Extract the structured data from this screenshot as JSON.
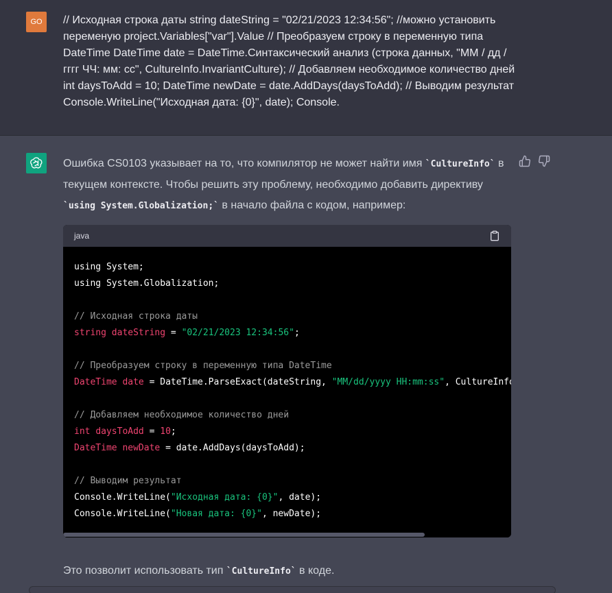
{
  "user": {
    "avatar_initials": "GO",
    "message": "// Исходная строка даты string dateString = \"02/21/2023 12:34:56\"; //можно установить переменую project.Variables[\"var\"].Value // Преобразуем строку в переменную типа DateTime DateTime date = DateTime.Синтаксический анализ (строка данных, \"ММ / дд / гггг ЧЧ: мм: сс\", CultureInfo.InvariantCulture); // Добавляем необходимое количество дней int daysToAdd = 10; DateTime newDate = date.AddDays(daysToAdd); // Выводим результат Console.WriteLine(\"Исходная дата: {0}\", date); Console."
  },
  "assistant": {
    "intro_1": "Ошибка CS0103 указывает на то, что компилятор не может найти имя ",
    "intro_code_1": "`CultureInfo`",
    "intro_2": " в текущем контексте. Чтобы решить эту проблему, необходимо добавить директиву ",
    "intro_code_2": "`using System.Globalization;`",
    "intro_3": " в начало файла с кодом, например:",
    "footer_1": "Это позволит использовать тип ",
    "footer_code": "`CultureInfo`",
    "footer_2": " в коде."
  },
  "code_block": {
    "language": "java",
    "copy_icon": "clipboard-icon",
    "lines": [
      [
        {
          "t": "using System;",
          "c": ""
        }
      ],
      [
        {
          "t": "using System.Globalization;",
          "c": ""
        }
      ],
      [],
      [
        {
          "t": "// Исходная строка даты",
          "c": "cm"
        }
      ],
      [
        {
          "t": "string",
          "c": "kw"
        },
        {
          "t": " ",
          "c": ""
        },
        {
          "t": "dateString",
          "c": "kw"
        },
        {
          "t": " = ",
          "c": ""
        },
        {
          "t": "\"02/21/2023 12:34:56\"",
          "c": "str"
        },
        {
          "t": ";",
          "c": ""
        }
      ],
      [],
      [
        {
          "t": "// Преобразуем строку в переменную типа DateTime",
          "c": "cm"
        }
      ],
      [
        {
          "t": "DateTime",
          "c": "kw"
        },
        {
          "t": " ",
          "c": ""
        },
        {
          "t": "date",
          "c": "kw"
        },
        {
          "t": " = DateTime.ParseExact(dateString, ",
          "c": ""
        },
        {
          "t": "\"MM/dd/yyyy HH:mm:ss\"",
          "c": "str"
        },
        {
          "t": ", CultureInfo.",
          "c": ""
        }
      ],
      [],
      [
        {
          "t": "// Добавляем необходимое количество дней",
          "c": "cm"
        }
      ],
      [
        {
          "t": "int",
          "c": "kw"
        },
        {
          "t": " ",
          "c": ""
        },
        {
          "t": "daysToAdd",
          "c": "kw"
        },
        {
          "t": " = ",
          "c": ""
        },
        {
          "t": "10",
          "c": "kw"
        },
        {
          "t": ";",
          "c": ""
        }
      ],
      [
        {
          "t": "DateTime",
          "c": "kw"
        },
        {
          "t": " ",
          "c": ""
        },
        {
          "t": "newDate",
          "c": "kw"
        },
        {
          "t": " = date.AddDays(daysToAdd);",
          "c": ""
        }
      ],
      [],
      [
        {
          "t": "// Выводим результат",
          "c": "cm"
        }
      ],
      [
        {
          "t": "Console.WriteLine(",
          "c": ""
        },
        {
          "t": "\"Исходная дата: {0}\"",
          "c": "str"
        },
        {
          "t": ", date);",
          "c": ""
        }
      ],
      [
        {
          "t": "Console.WriteLine(",
          "c": ""
        },
        {
          "t": "\"Новая дата: {0}\"",
          "c": "str"
        },
        {
          "t": ", newDate);",
          "c": ""
        }
      ]
    ]
  },
  "icons": {
    "user_avatar": "user-avatar",
    "bot_avatar": "openai-logo-icon",
    "thumbs_up": "thumbs-up-icon",
    "thumbs_down": "thumbs-down-icon"
  },
  "colors": {
    "user_avatar_bg": "#e07a3c",
    "bot_avatar_bg": "#10a37f",
    "keyword": "#ef4470",
    "string": "#19c37d",
    "comment": "#9b9b9b"
  }
}
